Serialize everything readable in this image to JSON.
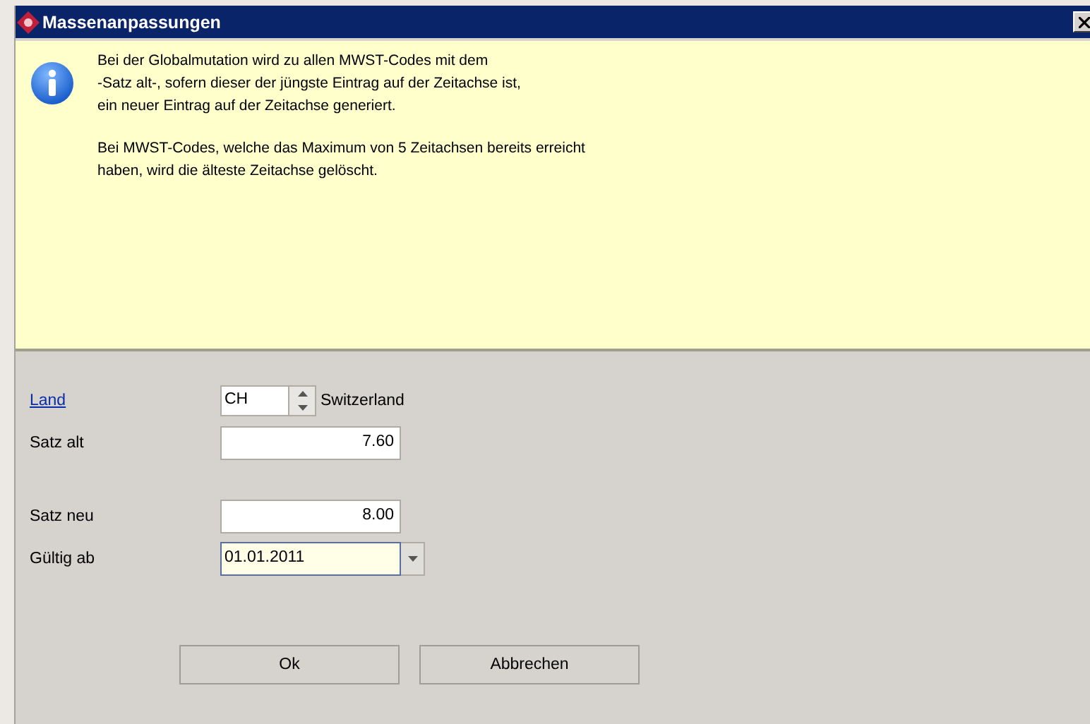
{
  "window": {
    "title": "Massenanpassungen"
  },
  "info": {
    "paragraphs": [
      "Bei der Globalmutation wird zu allen MWST-Codes mit dem\n-Satz alt-, sofern dieser der jüngste Eintrag auf der Zeitachse ist,\nein neuer Eintrag auf der Zeitachse generiert.",
      "Bei MWST-Codes, welche das Maximum von 5 Zeitachsen bereits erreicht\nhaben, wird die älteste Zeitachse gelöscht."
    ]
  },
  "form": [
    {
      "kind": "spinner",
      "label": "Land",
      "label_link": true,
      "value": "CH",
      "suffix": "Switzerland",
      "focused": false
    },
    {
      "kind": "number",
      "label": "Satz alt",
      "label_link": false,
      "value": "7.60",
      "focused": false
    },
    {
      "kind": "gap"
    },
    {
      "kind": "number",
      "label": "Satz neu",
      "label_link": false,
      "value": "8.00",
      "focused": false
    },
    {
      "kind": "date",
      "label": "Gültig ab",
      "label_link": false,
      "value": "01.01.2011",
      "focused": true
    }
  ],
  "buttons": [
    "Ok",
    "Abbrechen"
  ]
}
